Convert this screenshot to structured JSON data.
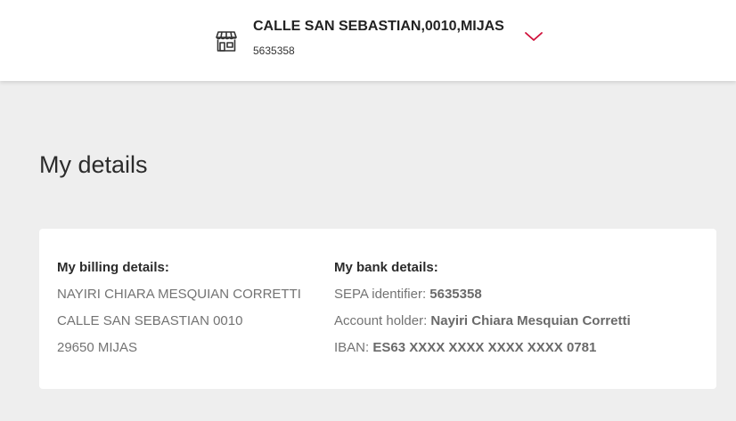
{
  "store": {
    "name": "CALLE SAN SEBASTIAN,0010,MIJAS",
    "code": "5635358",
    "icon": "store-icon",
    "dropdown_icon": "chevron-down-icon",
    "accent_color": "#d0103a"
  },
  "page": {
    "title": "My details"
  },
  "billing": {
    "heading": "My billing details:",
    "name": "NAYIRI CHIARA MESQUIAN CORRETTI",
    "street": "CALLE SAN SEBASTIAN 0010",
    "city": "29650 MIJAS"
  },
  "bank": {
    "heading": "My bank details:",
    "sepa_label": "SEPA identifier: ",
    "sepa_value": "5635358",
    "holder_label": "Account holder: ",
    "holder_value": "Nayiri Chiara Mesquian Corretti",
    "iban_label": "IBAN: ",
    "iban_value": "ES63 XXXX XXXX XXXX XXXX 0781"
  }
}
